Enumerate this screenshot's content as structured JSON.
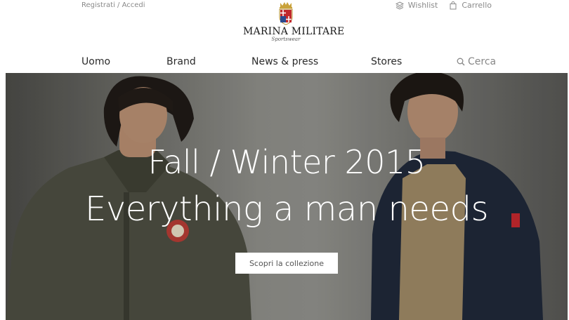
{
  "header": {
    "auth_link": "Registrati / Accedi",
    "wishlist_label": "Wishlist",
    "cart_label": "Carrello",
    "logo_text": "MARINA MILITARE",
    "logo_subtext": "Sportswear"
  },
  "nav": {
    "items": [
      {
        "label": "Uomo"
      },
      {
        "label": "Brand"
      },
      {
        "label": "News & press"
      },
      {
        "label": "Stores"
      }
    ],
    "search_label": "Cerca"
  },
  "hero": {
    "title_line1": "Fall / Winter 2015",
    "title_line2": "Everything a man needs",
    "cta_label": "Scopri la collezione"
  },
  "icons": {
    "wishlist": "layers-icon",
    "cart": "shopping-bag-icon",
    "search": "search-icon",
    "logo": "coat-of-arms-icon"
  },
  "colors": {
    "text_dark": "#2b2b2b",
    "text_muted": "#8a8a8a",
    "hero_text": "#ffffff"
  }
}
